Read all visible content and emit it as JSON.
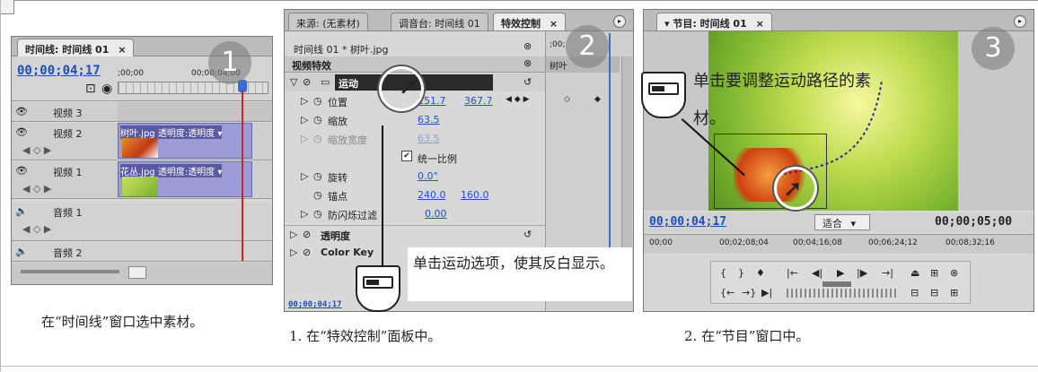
{
  "timeline_panel": {
    "tab_label": "时间线: 时间线 01",
    "timecode": "00;00;04;17",
    "ruler_start": ";00;00",
    "ruler_mark": "00;00;04;00",
    "tracks": {
      "video3": "视频 3",
      "video2": "视频 2",
      "video1": "视频 1",
      "audio1": "音频 1",
      "audio2": "音频 2"
    },
    "clip_v2": "树叶.jpg 透明度:透明度 ▾",
    "clip_v1": "花丛.jpg 透明度:透明度 ▾",
    "caption": "在“时间线”窗口选中素材。",
    "step": "1"
  },
  "effects_panel": {
    "tabs": [
      "来源: (无素材)",
      "调音台: 时间线 01",
      "特效控制"
    ],
    "close_glyph": "×",
    "clip_name": "时间线 01 * 树叶.jpg",
    "section_label": "视频特效",
    "motion_label": "运动",
    "position_label": "位置",
    "position_x": "151.7",
    "position_y": "367.7",
    "scale_label": "缩放",
    "scale_value": "63.5",
    "scale_width_label": "缩放宽度",
    "scale_width_value": "63.5",
    "uniform_label": "统一比例",
    "rotation_label": "旋转",
    "rotation_value": "0.0°",
    "anchor_label": "锚点",
    "anchor_x": "240.0",
    "anchor_y": "160.0",
    "flicker_label": "防闪烁过滤",
    "flicker_value": "0.00",
    "opacity_label": "透明度",
    "colorkey_label": "Color Key",
    "mini_timecode": ";00;",
    "mini_clip": "树叶",
    "footer_timecode": "00;00;04;17",
    "note_text": "单击运动选项，使其反白显示。",
    "caption": "1. 在“特效控制”面板中。",
    "step": "2"
  },
  "program_panel": {
    "tab_label": "▾ 节目: 时间线 01",
    "note_text": "单击要调整运动路径的素材。",
    "timecode_left": "00;00;04;17",
    "fit_label": "适合",
    "timecode_right": "00;00;05;00",
    "ruler": [
      "00;00",
      "00;02;08;04",
      "00;04;16;08",
      "00;06;24;12",
      "00;08;32;16"
    ],
    "caption": "2. 在“节目”窗口中。",
    "step": "3"
  },
  "colors": {
    "timecode_blue": "#1d4fb6",
    "track_purple": "#9c9cd8",
    "playhead_red": "#e02020"
  }
}
